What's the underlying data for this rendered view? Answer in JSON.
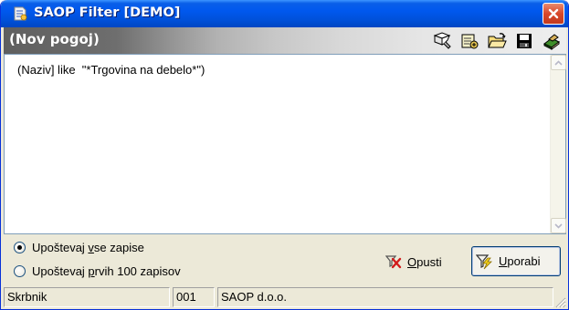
{
  "window": {
    "title": "SAOP Filter [DEMO]"
  },
  "header": {
    "label": "(Nov pogoj)"
  },
  "toolbar": {
    "icons": [
      "edit-condition-icon",
      "wizard-icon",
      "open-folder-icon",
      "save-disk-icon",
      "book-icon"
    ]
  },
  "editor": {
    "text": "(Naziv] like  \"*Trgovina na debelo*\")"
  },
  "options": {
    "all_records": {
      "prefix": "Upoštevaj ",
      "accel": "v",
      "suffix": "se zapise",
      "checked": true
    },
    "first_records": {
      "prefix": "Upoštevaj ",
      "accel": "p",
      "suffix": "rvih 100 zapisov",
      "checked": false
    }
  },
  "buttons": {
    "cancel": {
      "accel": "O",
      "rest": "pusti"
    },
    "apply": {
      "accel": "U",
      "rest": "porabi"
    }
  },
  "status": {
    "user": "Skrbnik",
    "code": "001",
    "company": "SAOP d.o.o."
  },
  "colors": {
    "titlebar": "#0058ee",
    "close": "#d8472a",
    "strip_dark": "#5f5f5f",
    "window_bg": "#ece9d8"
  }
}
